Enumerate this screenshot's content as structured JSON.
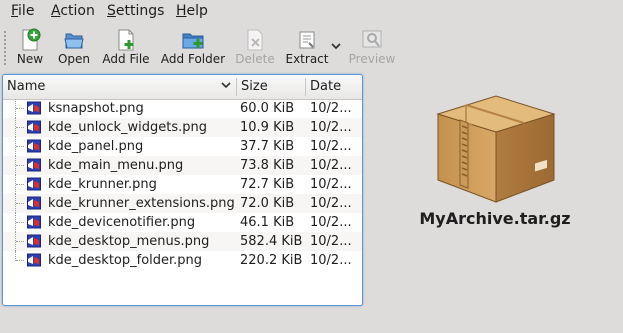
{
  "menubar": {
    "items": [
      {
        "label": "File",
        "accel": "F"
      },
      {
        "label": "Action",
        "accel": "A"
      },
      {
        "label": "Settings",
        "accel": "S"
      },
      {
        "label": "Help",
        "accel": "H"
      }
    ]
  },
  "toolbar": {
    "new_label": "New",
    "open_label": "Open",
    "add_file_label": "Add File",
    "add_folder_label": "Add Folder",
    "delete_label": "Delete",
    "extract_label": "Extract",
    "preview_label": "Preview",
    "disabled": [
      "Delete",
      "Preview"
    ]
  },
  "file_list": {
    "columns": [
      "Name",
      "Size",
      "Date"
    ],
    "sort_column": "Name",
    "rows": [
      {
        "name": "ksnapshot.png",
        "size": "60.0 KiB",
        "date": "10/2..."
      },
      {
        "name": "kde_unlock_widgets.png",
        "size": "10.9 KiB",
        "date": "10/2..."
      },
      {
        "name": "kde_panel.png",
        "size": "37.7 KiB",
        "date": "10/2..."
      },
      {
        "name": "kde_main_menu.png",
        "size": "73.8 KiB",
        "date": "10/2..."
      },
      {
        "name": "kde_krunner.png",
        "size": "72.7 KiB",
        "date": "10/2..."
      },
      {
        "name": "kde_krunner_extensions.png",
        "size": "72.0 KiB",
        "date": "10/2..."
      },
      {
        "name": "kde_devicenotifier.png",
        "size": "46.1 KiB",
        "date": "10/2..."
      },
      {
        "name": "kde_desktop_menus.png",
        "size": "582.4 KiB",
        "date": "10/2..."
      },
      {
        "name": "kde_desktop_folder.png",
        "size": "220.2 KiB",
        "date": "10/2..."
      }
    ]
  },
  "archive": {
    "name": "MyArchive.tar.gz",
    "icon": "package-archive-icon"
  },
  "colors": {
    "window_bg": "#dedcda",
    "focus_border": "#5c97cf",
    "disabled_text": "#a7a5a3"
  }
}
